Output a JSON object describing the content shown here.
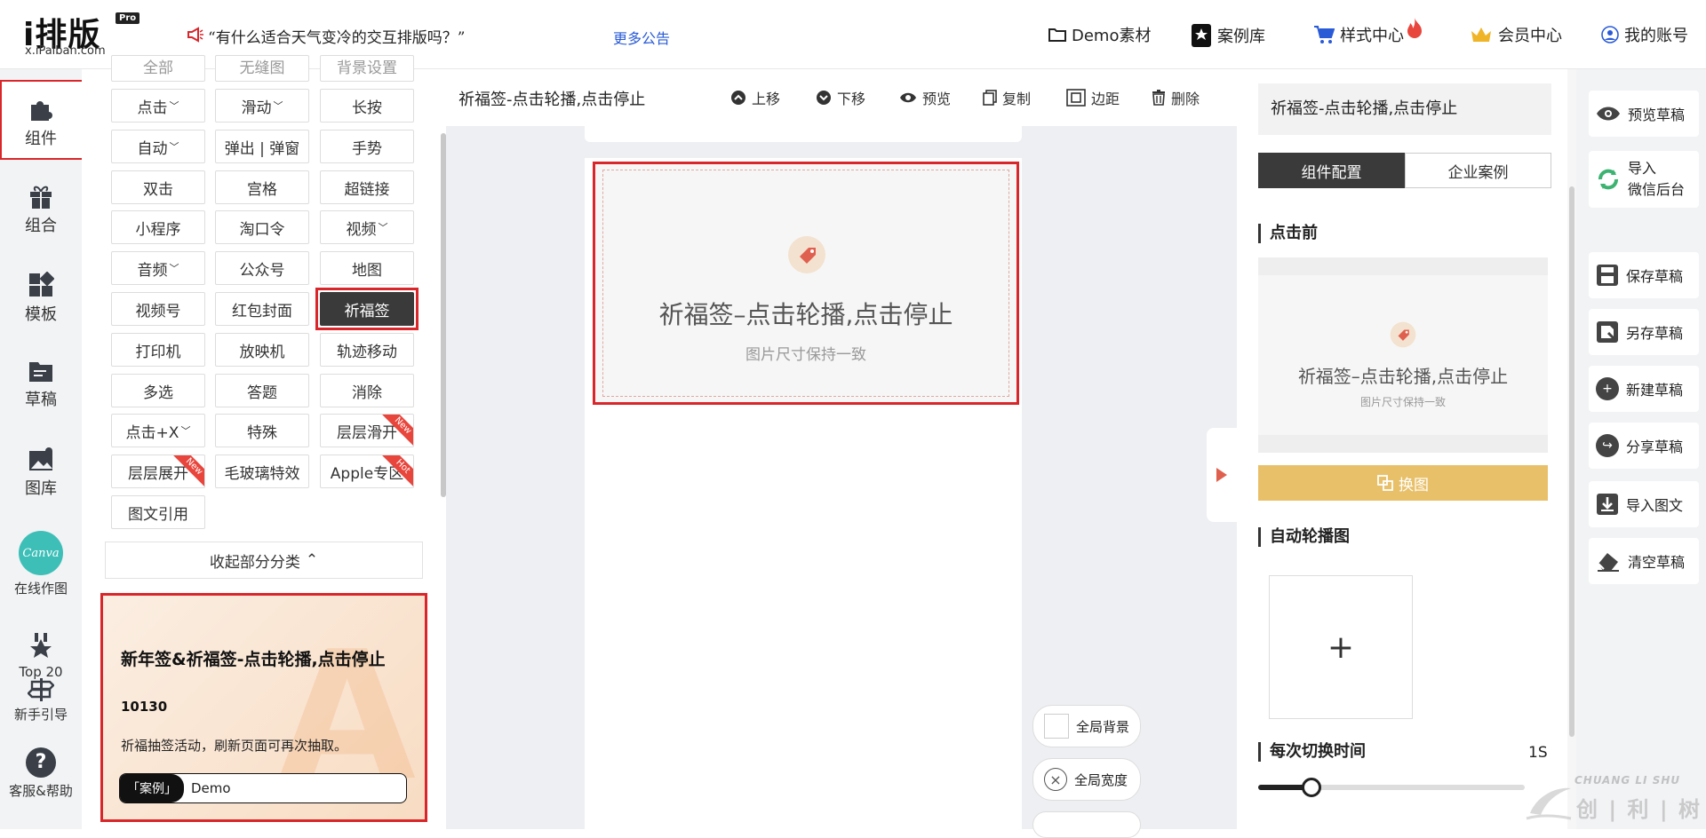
{
  "logo": {
    "main": "i排版",
    "badge": "Pro",
    "domain": "x.iPaiban.com"
  },
  "announcement": {
    "text": "“有什么适合天气变冷的交互排版吗？”",
    "more": "更多公告"
  },
  "nav": {
    "demo": "Demo素材",
    "cases": "案例库",
    "style": "样式中心",
    "member": "会员中心",
    "account": "我的账号"
  },
  "rail": {
    "items": [
      {
        "label": "组件",
        "icon": "puzzle-icon"
      },
      {
        "label": "组合",
        "icon": "gift-icon"
      },
      {
        "label": "模板",
        "icon": "grid-icon"
      },
      {
        "label": "草稿",
        "icon": "folder-icon"
      },
      {
        "label": "图库",
        "icon": "image-icon"
      },
      {
        "label": "在线作图",
        "icon": "canva-icon",
        "logo_text": "Canva"
      },
      {
        "label": "Top 20",
        "icon": "star-badge-icon"
      },
      {
        "label": "新手引导",
        "icon": "guide-icon"
      },
      {
        "label": "客服&帮助",
        "icon": "help-icon"
      }
    ]
  },
  "widgets": {
    "partial_top": [
      "全部",
      "无缝图",
      "背景设置"
    ],
    "rows": [
      [
        "点击",
        "滑动",
        "长按"
      ],
      [
        "自动",
        "弹出 | 弹窗",
        "手势"
      ],
      [
        "双击",
        "宫格",
        "超链接"
      ],
      [
        "小程序",
        "淘口令",
        "视频"
      ],
      [
        "音频",
        "公众号",
        "地图"
      ],
      [
        "视频号",
        "红包封面",
        "祈福签"
      ],
      [
        "打印机",
        "放映机",
        "轨迹移动"
      ],
      [
        "多选",
        "答题",
        "消除"
      ],
      [
        "点击+X",
        "特殊",
        "层层滑开"
      ],
      [
        "层层展开",
        "毛玻璃特效",
        "Apple专区"
      ],
      [
        "图文引用"
      ]
    ],
    "ribbons": {
      "new": "New",
      "hot": "Hot"
    },
    "collapse": "收起部分分类"
  },
  "promo": {
    "title": "新年签&祈福签-点击轮播,点击停止",
    "number": "10130",
    "desc": "祈福抽签活动，刷新页面可再次抽取。",
    "tag": "「案例」",
    "demo": "Demo",
    "bg_letter": "A"
  },
  "toolbar": {
    "title": "祈福签-点击轮播,点击停止",
    "up": "上移",
    "down": "下移",
    "preview": "预览",
    "copy": "复制",
    "margin": "边距",
    "delete": "删除"
  },
  "canvas": {
    "title": "祈福签–点击轮播,点击停止",
    "subtitle": "图片尺寸保持一致",
    "global_bg": "全局背景",
    "global_width": "全局宽度"
  },
  "config": {
    "title": "祈福签-点击轮播,点击停止",
    "tab_active": "组件配置",
    "tab_other": "企业案例",
    "before_click": "点击前",
    "preview_title": "祈福签–点击轮播,点击停止",
    "preview_sub": "图片尺寸保持一致",
    "swap": "换图",
    "auto_carousel": "自动轮播图",
    "add": "+",
    "switch_time": "每次切换时间",
    "switch_value": "1S",
    "slider_fraction": 0.2
  },
  "actions": {
    "preview_draft": "预览草稿",
    "import_wechat_1": "导入",
    "import_wechat_2": "微信后台",
    "save": "保存草稿",
    "save_as": "另存草稿",
    "new": "新建草稿",
    "share": "分享草稿",
    "import_text": "导入图文",
    "clear": "清空草稿"
  },
  "watermark": {
    "en": "CHUANG LI SHU",
    "cn": "创 | 利 | 树"
  },
  "colors": {
    "accent_red": "#d9262a",
    "dark": "#3a3a3a",
    "swap_btn": "#e8c069",
    "link": "#2a5bd7"
  }
}
